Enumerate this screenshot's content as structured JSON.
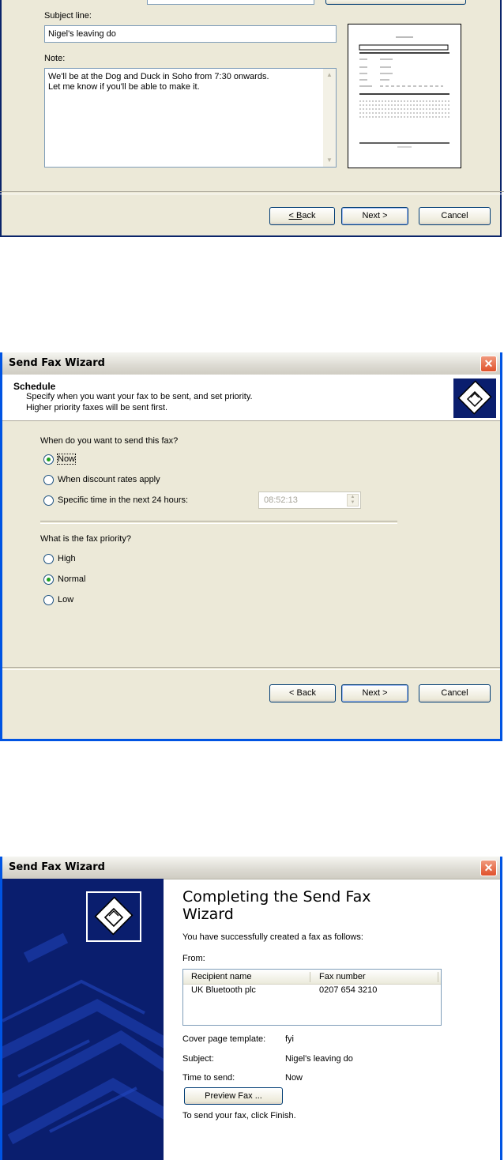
{
  "cover": {
    "subject_label": "Subject line:",
    "subject_value": "Nigel's leaving do",
    "note_label": "Note:",
    "note_line1": "We'll be at the Dog and Duck in Soho from 7:30 onwards.",
    "note_line2": "Let me know if you'll be able to make it.",
    "back": "< Back",
    "next": "Next >",
    "cancel": "Cancel"
  },
  "schedule": {
    "window_title": "Send Fax Wizard",
    "heading": "Schedule",
    "desc1": "Specify when you want your fax to be sent, and set priority.",
    "desc2": "Higher priority faxes will be sent first.",
    "when_q": "When do you want to send this fax?",
    "opt_now": "Now",
    "opt_discount": "When discount rates apply",
    "opt_specific": "Specific time in the next 24 hours:",
    "time_value": "08:52:13",
    "priority_q": "What is the fax priority?",
    "opt_high": "High",
    "opt_normal": "Normal",
    "opt_low": "Low",
    "back": "< Back",
    "next": "Next >",
    "cancel": "Cancel",
    "selected_when": "Now",
    "selected_priority": "Normal"
  },
  "complete": {
    "window_title": "Send Fax Wizard",
    "heading1": "Completing the Send Fax",
    "heading2": "Wizard",
    "intro": "You have successfully created a fax as follows:",
    "from_label": "From:",
    "col_name": "Recipient name",
    "col_fax": "Fax number",
    "recipients": [
      {
        "name": "UK Bluetooth plc",
        "fax": "0207 654 3210"
      }
    ],
    "cover_label": "Cover page template:",
    "cover_value": "fyi",
    "subject_label": "Subject:",
    "subject_value": "Nigel's leaving do",
    "time_label": "Time to send:",
    "time_value": "Now",
    "preview_button": "Preview Fax ...",
    "finish_hint": "To send your fax, click Finish."
  },
  "colors": {
    "window_border": "#0054e3",
    "panel_bg": "#ece9d8",
    "side_panel": "#0a1e6e",
    "close": "#e0512b"
  }
}
